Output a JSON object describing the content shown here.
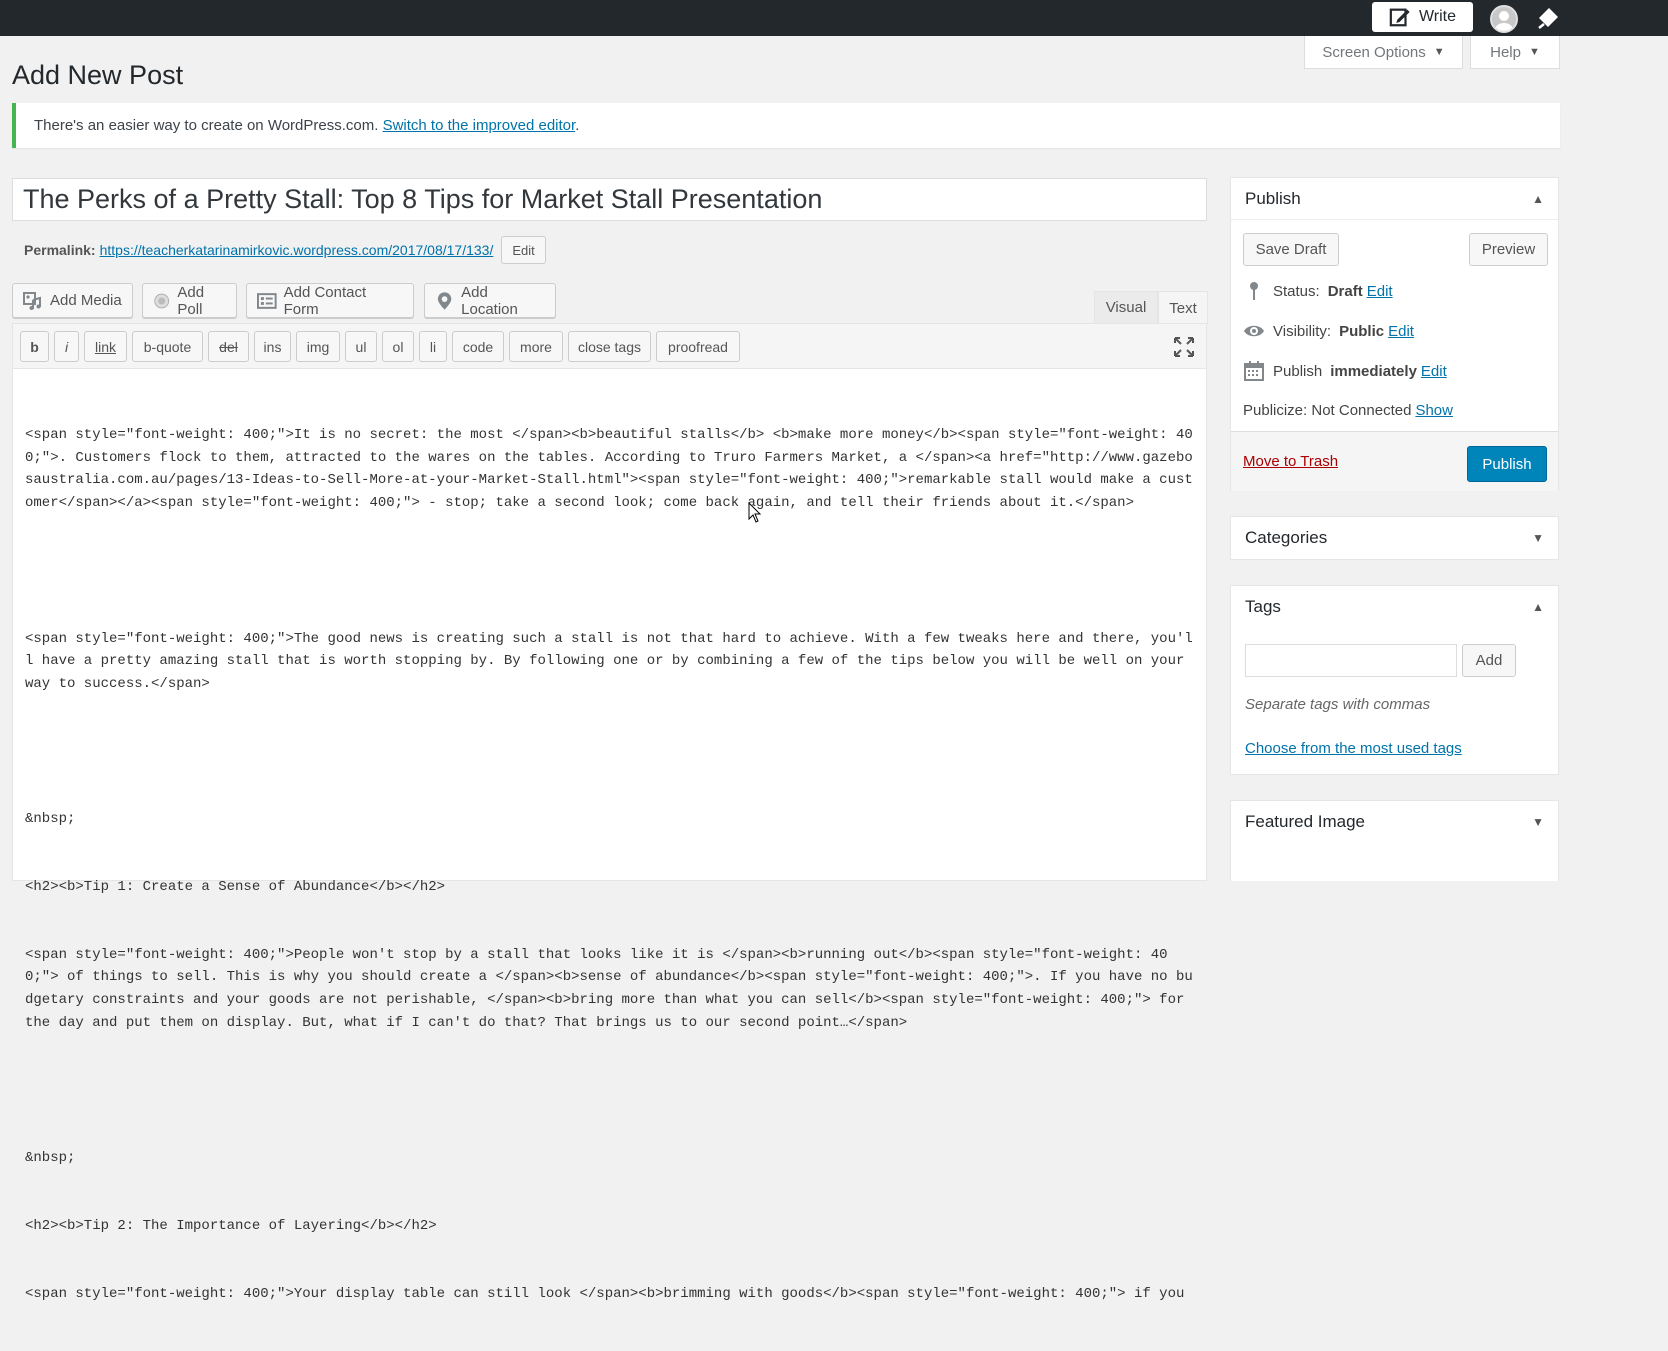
{
  "admin_bar": {
    "write_label": "Write"
  },
  "header": {
    "screen_options_label": "Screen Options",
    "help_label": "Help",
    "page_title": "Add New Post"
  },
  "notice": {
    "text": "There's an easier way to create on WordPress.com.",
    "link_text": "Switch to the improved editor",
    "trailing": "."
  },
  "post": {
    "title": "The Perks of a Pretty Stall: Top 8 Tips for Market Stall Presentation",
    "permalink_label": "Permalink:",
    "permalink_url": "https://teacherkatarinamirkovic.wordpress.com/2017/08/17/133/",
    "permalink_edit": "Edit"
  },
  "media_buttons": {
    "add_media": "Add Media",
    "add_poll": "Add Poll",
    "add_contact_form": "Add Contact Form",
    "add_location": "Add Location"
  },
  "editor_tabs": {
    "visual": "Visual",
    "text": "Text",
    "active": "Text"
  },
  "quicktags": [
    "b",
    "i",
    "link",
    "b-quote",
    "del",
    "ins",
    "img",
    "ul",
    "ol",
    "li",
    "code",
    "more",
    "close tags",
    "proofread"
  ],
  "content_lines": [
    "<span style=\"font-weight: 400;\">It is no secret: the most </span><b>beautiful stalls</b> <b>make more money</b><span style=\"font-weight: 400;\">. Customers flock to them, attracted to the wares on the tables. According to Truro Farmers Market, a </span><a href=\"http://www.gazebosaustralia.com.au/pages/13-Ideas-to-Sell-More-at-your-Market-Stall.html\"><span style=\"font-weight: 400;\">remarkable stall would make a customer</span></a><span style=\"font-weight: 400;\"> - stop; take a second look; come back again, and tell their friends about it.</span>",
    "",
    "<span style=\"font-weight: 400;\">The good news is creating such a stall is not that hard to achieve. With a few tweaks here and there, you'll have a pretty amazing stall that is worth stopping by. By following one or by combining a few of the tips below you will be well on your way to success.</span>",
    "",
    "&nbsp;",
    "<h2><b>Tip 1: Create a Sense of Abundance</b></h2>",
    "<span style=\"font-weight: 400;\">People won't stop by a stall that looks like it is </span><b>running out</b><span style=\"font-weight: 400;\"> of things to sell. This is why you should create a </span><b>sense of abundance</b><span style=\"font-weight: 400;\">. If you have no budgetary constraints and your goods are not perishable, </span><b>bring more than what you can sell</b><span style=\"font-weight: 400;\"> for the day and put them on display. But, what if I can't do that? That brings us to our second point…</span>",
    "",
    "&nbsp;",
    "<h2><b>Tip 2: The Importance of Layering</b></h2>",
    "<span style=\"font-weight: 400;\">Your display table can still look </span><b>brimming with goods</b><span style=\"font-weight: 400;\"> if you"
  ],
  "publish": {
    "title": "Publish",
    "save_draft": "Save Draft",
    "preview": "Preview",
    "status_label": "Status:",
    "status_value": "Draft",
    "visibility_label": "Visibility:",
    "visibility_value": "Public",
    "schedule_label": "Publish",
    "schedule_value": "immediately",
    "edit_link": "Edit",
    "publicize_label": "Publicize: Not Connected",
    "publicize_link": "Show",
    "trash_link": "Move to Trash",
    "publish_button": "Publish"
  },
  "categories": {
    "title": "Categories"
  },
  "tags": {
    "title": "Tags",
    "input_value": "",
    "add_button": "Add",
    "hint": "Separate tags with commas",
    "choose_link": "Choose from the most used tags"
  },
  "featured_image": {
    "title": "Featured Image"
  },
  "colors": {
    "primary": "#0085ba",
    "link": "#0073aa",
    "admin_bar": "#23282d",
    "notice_border": "#46b450",
    "trash": "#a00"
  }
}
